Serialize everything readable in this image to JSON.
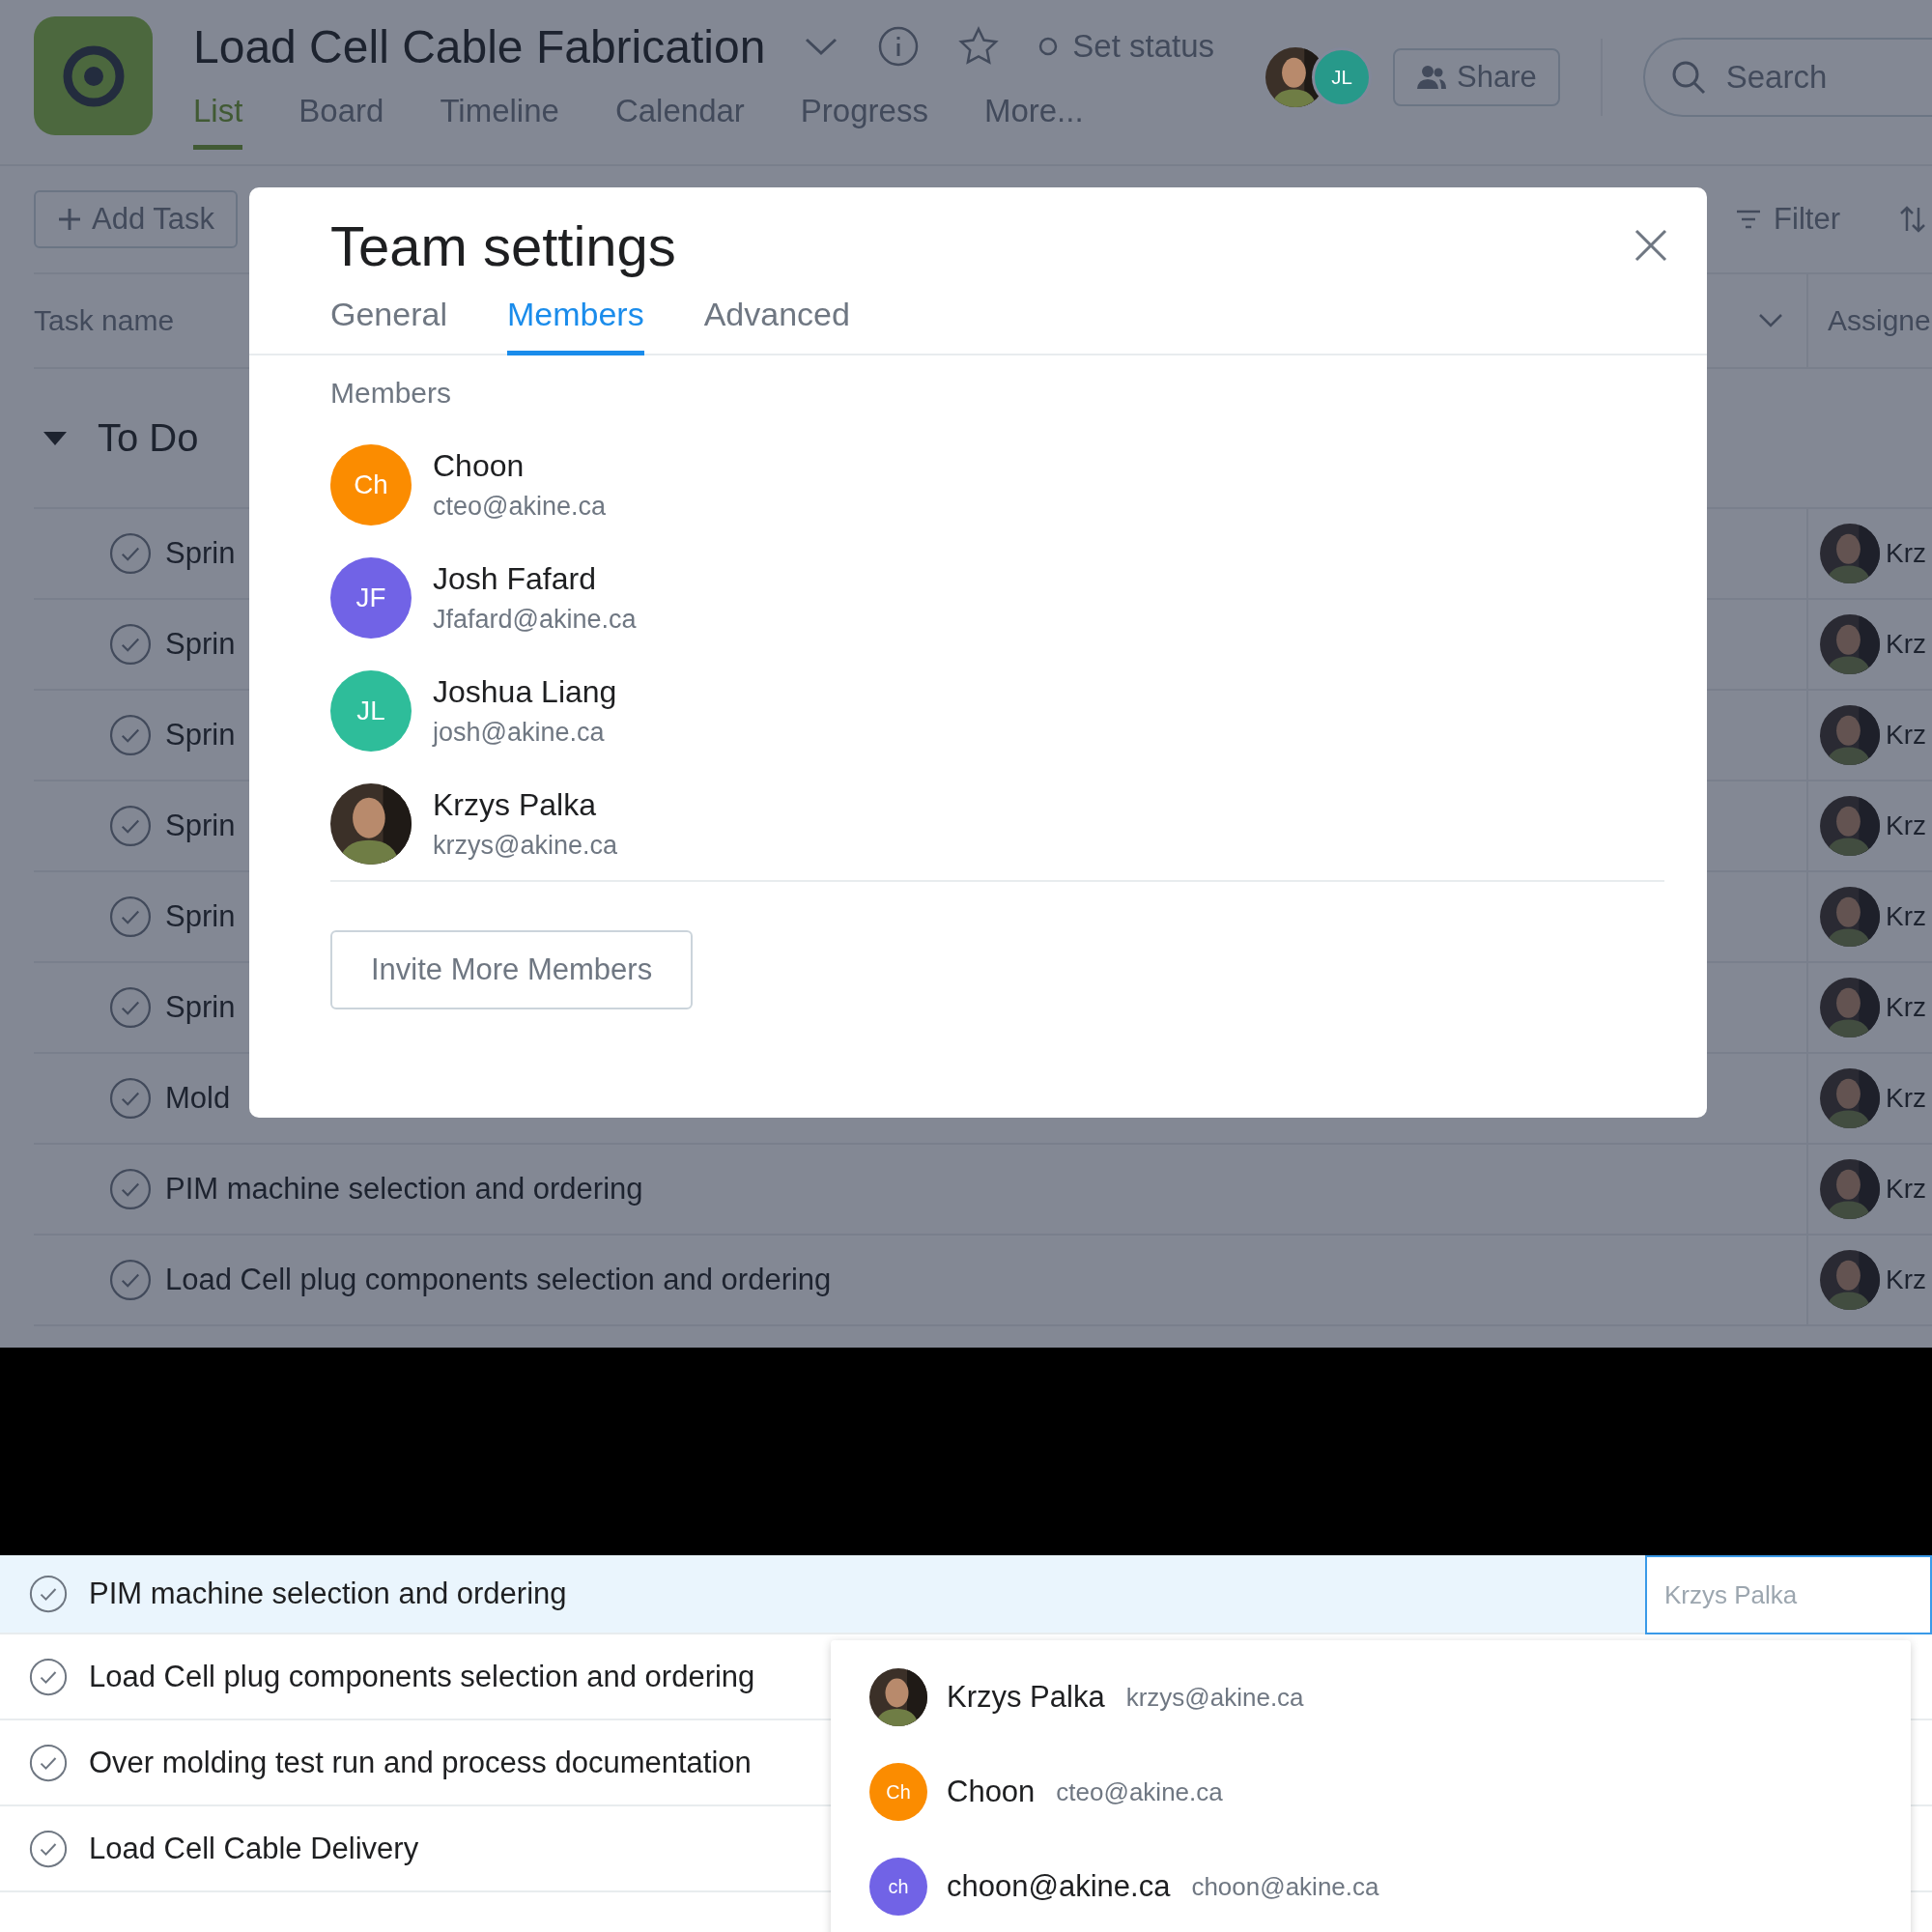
{
  "project": {
    "title": "Load Cell Cable Fabrication",
    "status": "Set status",
    "share": "Share",
    "search_placeholder": "Search",
    "views": [
      {
        "label": "List",
        "selected": true
      },
      {
        "label": "Board",
        "selected": false
      },
      {
        "label": "Timeline",
        "selected": false
      },
      {
        "label": "Calendar",
        "selected": false
      },
      {
        "label": "Progress",
        "selected": false
      },
      {
        "label": "More...",
        "selected": false
      }
    ],
    "members": [
      {
        "kind": "photo"
      },
      {
        "kind": "initials",
        "initials": "JL",
        "color": "#27998a"
      }
    ]
  },
  "toolbar": {
    "add_task": "Add Task",
    "filter": "Filter"
  },
  "list": {
    "columns": [
      "Task name",
      "Assigne"
    ],
    "section": {
      "title": "To Do",
      "expanded": true
    },
    "rows": [
      {
        "name": "Sprin",
        "assignee": "Krz"
      },
      {
        "name": "Sprin",
        "assignee": "Krz"
      },
      {
        "name": "Sprin",
        "assignee": "Krz"
      },
      {
        "name": "Sprin",
        "assignee": "Krz"
      },
      {
        "name": "Sprin",
        "assignee": "Krz"
      },
      {
        "name": "Sprin",
        "assignee": "Krz"
      },
      {
        "name": "Mold",
        "assignee": "Krz"
      },
      {
        "name": "PIM machine selection and ordering",
        "assignee": "Krz"
      },
      {
        "name": "Load Cell plug components selection and ordering",
        "assignee": "Krz"
      }
    ]
  },
  "dialog": {
    "title": "Team settings",
    "section": "Members",
    "invite": "Invite More Members",
    "tabs": [
      {
        "label": "General",
        "selected": false
      },
      {
        "label": "Members",
        "selected": true
      },
      {
        "label": "Advanced",
        "selected": false
      }
    ],
    "members": [
      {
        "name": "Choon",
        "email": "cteo@akine.ca",
        "avatar": {
          "kind": "initials",
          "initials": "Ch",
          "color": "#fb8c00"
        }
      },
      {
        "name": "Josh Fafard",
        "email": "Jfafard@akine.ca",
        "avatar": {
          "kind": "initials",
          "initials": "JF",
          "color": "#7163e6"
        }
      },
      {
        "name": "Joshua Liang",
        "email": "josh@akine.ca",
        "avatar": {
          "kind": "initials",
          "initials": "JL",
          "color": "#2ebd9a"
        }
      },
      {
        "name": "Krzys Palka",
        "email": "krzys@akine.ca",
        "avatar": {
          "kind": "photo"
        }
      }
    ]
  },
  "lower_list": {
    "assignee_field": {
      "placeholder": "Krzys Palka"
    },
    "rows": [
      {
        "name": "PIM machine selection and ordering",
        "selected": true
      },
      {
        "name": "Load Cell plug components selection and ordering",
        "selected": false
      },
      {
        "name": "Over molding test run and process documentation",
        "selected": false
      },
      {
        "name": "Load Cell Cable Delivery",
        "selected": false
      }
    ],
    "suggestions": [
      {
        "name": "Krzys Palka",
        "email": "krzys@akine.ca",
        "avatar": {
          "kind": "photo"
        }
      },
      {
        "name": "Choon",
        "email": "cteo@akine.ca",
        "avatar": {
          "kind": "initials",
          "initials": "Ch",
          "color": "#fb8c00"
        }
      },
      {
        "name": "choon@akine.ca",
        "email": "choon@akine.ca",
        "avatar": {
          "kind": "initials",
          "initials": "ch",
          "color": "#7163e6"
        }
      }
    ]
  }
}
